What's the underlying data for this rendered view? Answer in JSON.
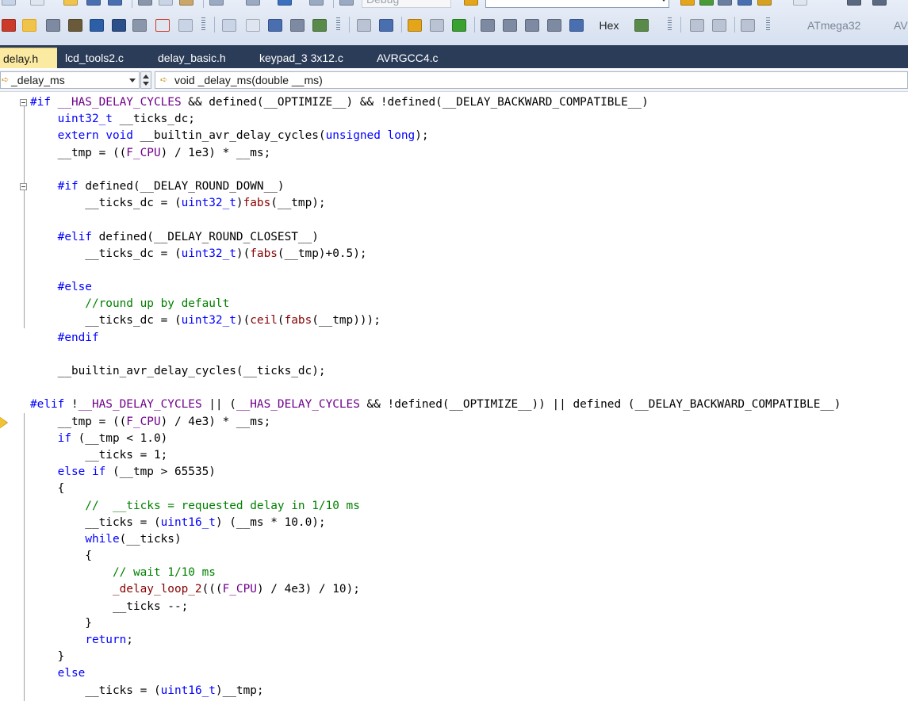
{
  "toolbar": {
    "config_combo": "Debug",
    "hex_label": "Hex",
    "device_label": "ATmega32",
    "device_label_2": "AV",
    "colors": {
      "bg": "#dbe4f1",
      "accent": "#e4a51a"
    }
  },
  "tabs": [
    {
      "label": "delay.h",
      "active": true
    },
    {
      "label": "lcd_tools2.c",
      "active": false
    },
    {
      "label": "delay_basic.h",
      "active": false
    },
    {
      "label": "keypad_3 3x12.c",
      "active": false
    },
    {
      "label": "AVRGCC4.c",
      "active": false
    }
  ],
  "navbar": {
    "scope": "_delay_ms",
    "member": "void _delay_ms(double __ms)"
  },
  "editor": {
    "colors": {
      "keyword": "#0000ff",
      "macro": "#6f008a",
      "function": "#880000",
      "comment": "#008000"
    },
    "lines": [
      [
        [
          "pp",
          "#if "
        ],
        [
          "mac",
          "__HAS_DELAY_CYCLES"
        ],
        [
          "t",
          " && defined(__OPTIMIZE__) && !defined(__DELAY_BACKWARD_COMPATIBLE__)"
        ]
      ],
      [
        [
          "t",
          "    "
        ],
        [
          "kw",
          "uint32_t"
        ],
        [
          "t",
          " __ticks_dc;"
        ]
      ],
      [
        [
          "t",
          "    "
        ],
        [
          "kw",
          "extern"
        ],
        [
          "t",
          " "
        ],
        [
          "kw",
          "void"
        ],
        [
          "t",
          " __builtin_avr_delay_cycles("
        ],
        [
          "kw",
          "unsigned"
        ],
        [
          "t",
          " "
        ],
        [
          "kw",
          "long"
        ],
        [
          "t",
          ");"
        ]
      ],
      [
        [
          "t",
          "    __tmp = (("
        ],
        [
          "mac",
          "F_CPU"
        ],
        [
          "t",
          ") / 1e3) * __ms;"
        ]
      ],
      [
        [
          "t",
          ""
        ]
      ],
      [
        [
          "t",
          "    "
        ],
        [
          "kw",
          "#if"
        ],
        [
          "t",
          " defined(__DELAY_ROUND_DOWN__)"
        ]
      ],
      [
        [
          "t",
          "        __ticks_dc = ("
        ],
        [
          "kw",
          "uint32_t"
        ],
        [
          "t",
          ")"
        ],
        [
          "fn",
          "fabs"
        ],
        [
          "t",
          "(__tmp);"
        ]
      ],
      [
        [
          "t",
          ""
        ]
      ],
      [
        [
          "t",
          "    "
        ],
        [
          "kw",
          "#elif"
        ],
        [
          "t",
          " defined(__DELAY_ROUND_CLOSEST__)"
        ]
      ],
      [
        [
          "t",
          "        __ticks_dc = ("
        ],
        [
          "kw",
          "uint32_t"
        ],
        [
          "t",
          ")("
        ],
        [
          "fn",
          "fabs"
        ],
        [
          "t",
          "(__tmp)+0.5);"
        ]
      ],
      [
        [
          "t",
          ""
        ]
      ],
      [
        [
          "t",
          "    "
        ],
        [
          "kw",
          "#else"
        ]
      ],
      [
        [
          "cm",
          "        //round up by default"
        ]
      ],
      [
        [
          "t",
          "        __ticks_dc = ("
        ],
        [
          "kw",
          "uint32_t"
        ],
        [
          "t",
          ")("
        ],
        [
          "fn",
          "ceil"
        ],
        [
          "t",
          "("
        ],
        [
          "fn",
          "fabs"
        ],
        [
          "t",
          "(__tmp)));"
        ]
      ],
      [
        [
          "t",
          "    "
        ],
        [
          "kw",
          "#endif"
        ]
      ],
      [
        [
          "t",
          ""
        ]
      ],
      [
        [
          "t",
          "    __builtin_avr_delay_cycles(__ticks_dc);"
        ]
      ],
      [
        [
          "t",
          ""
        ]
      ],
      [
        [
          "kw",
          "#elif"
        ],
        [
          "t",
          " !"
        ],
        [
          "mac",
          "__HAS_DELAY_CYCLES"
        ],
        [
          "t",
          " || ("
        ],
        [
          "mac",
          "__HAS_DELAY_CYCLES"
        ],
        [
          "t",
          " && !defined(__OPTIMIZE__)) || defined (__DELAY_BACKWARD_COMPATIBLE__)"
        ]
      ],
      [
        [
          "t",
          "    __tmp = (("
        ],
        [
          "mac",
          "F_CPU"
        ],
        [
          "t",
          ") / 4e3) * __ms;"
        ]
      ],
      [
        [
          "t",
          "    "
        ],
        [
          "kw",
          "if"
        ],
        [
          "t",
          " (__tmp < 1.0)"
        ]
      ],
      [
        [
          "t",
          "        __ticks = 1;"
        ]
      ],
      [
        [
          "t",
          "    "
        ],
        [
          "kw",
          "else"
        ],
        [
          "t",
          " "
        ],
        [
          "kw",
          "if"
        ],
        [
          "t",
          " (__tmp > 65535)"
        ]
      ],
      [
        [
          "t",
          "    {"
        ]
      ],
      [
        [
          "cm",
          "        //  __ticks = requested delay in 1/10 ms"
        ]
      ],
      [
        [
          "t",
          "        __ticks = ("
        ],
        [
          "kw",
          "uint16_t"
        ],
        [
          "t",
          ") (__ms * 10.0);"
        ]
      ],
      [
        [
          "t",
          "        "
        ],
        [
          "kw",
          "while"
        ],
        [
          "t",
          "(__ticks)"
        ]
      ],
      [
        [
          "t",
          "        {"
        ]
      ],
      [
        [
          "cm",
          "            // wait 1/10 ms"
        ]
      ],
      [
        [
          "t",
          "            "
        ],
        [
          "fn",
          "_delay_loop_2"
        ],
        [
          "t",
          "((("
        ],
        [
          "mac",
          "F_CPU"
        ],
        [
          "t",
          ") / 4e3) / 10);"
        ]
      ],
      [
        [
          "t",
          "            __ticks --;"
        ]
      ],
      [
        [
          "t",
          "        }"
        ]
      ],
      [
        [
          "t",
          "        "
        ],
        [
          "kw",
          "return"
        ],
        [
          "t",
          ";"
        ]
      ],
      [
        [
          "t",
          "    }"
        ]
      ],
      [
        [
          "t",
          "    "
        ],
        [
          "kw",
          "else"
        ]
      ],
      [
        [
          "t",
          "        __ticks = ("
        ],
        [
          "kw",
          "uint16_t"
        ],
        [
          "t",
          ")__tmp;"
        ]
      ]
    ]
  }
}
